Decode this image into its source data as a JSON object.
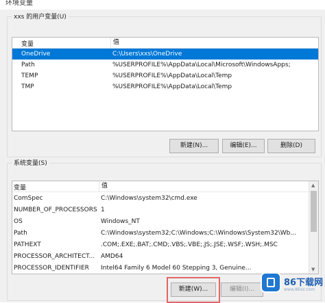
{
  "window": {
    "title": "环境变量"
  },
  "user_group": {
    "label": "xxs 的用户变量(U)",
    "columns": [
      "变量",
      "值"
    ],
    "rows": [
      {
        "name": "OneDrive",
        "value": "C:\\Users\\xxs\\OneDrive",
        "selected": true
      },
      {
        "name": "Path",
        "value": "%USERPROFILE%\\AppData\\Local\\Microsoft\\WindowsApps;"
      },
      {
        "name": "TEMP",
        "value": "%USERPROFILE%\\AppData\\Local\\Temp"
      },
      {
        "name": "TMP",
        "value": "%USERPROFILE%\\AppData\\Local\\Temp"
      }
    ],
    "buttons": {
      "new": "新建(N)...",
      "edit": "编辑(E)...",
      "delete": "删除(D)"
    }
  },
  "sys_group": {
    "label": "系统变量(S)",
    "columns": [
      "变量",
      "值"
    ],
    "rows": [
      {
        "name": "ComSpec",
        "value": "C:\\Windows\\system32\\cmd.exe"
      },
      {
        "name": "NUMBER_OF_PROCESSORS",
        "value": "1"
      },
      {
        "name": "OS",
        "value": "Windows_NT"
      },
      {
        "name": "Path",
        "value": "C:\\Windows\\system32;C:\\Windows;C:\\Windows\\System32\\Wb..."
      },
      {
        "name": "PATHEXT",
        "value": ".COM;.EXE;.BAT;.CMD;.VBS;.VBE;.JS;.JSE;.WSF;.WSH;.MSC"
      },
      {
        "name": "PROCESSOR_ARCHITECT...",
        "value": "AMD64"
      },
      {
        "name": "PROCESSOR_IDENTIFIER",
        "value": "Intel64 Family 6 Model 60 Stepping 3, Genuine..."
      }
    ],
    "buttons": {
      "new": "新建(W)...",
      "edit": "编辑(I)..."
    }
  },
  "watermark": {
    "brand": "86下载网",
    "sub": "www.86xz.com"
  },
  "colors": {
    "selection": "#0078d7",
    "highlight_border": "#e06666"
  }
}
